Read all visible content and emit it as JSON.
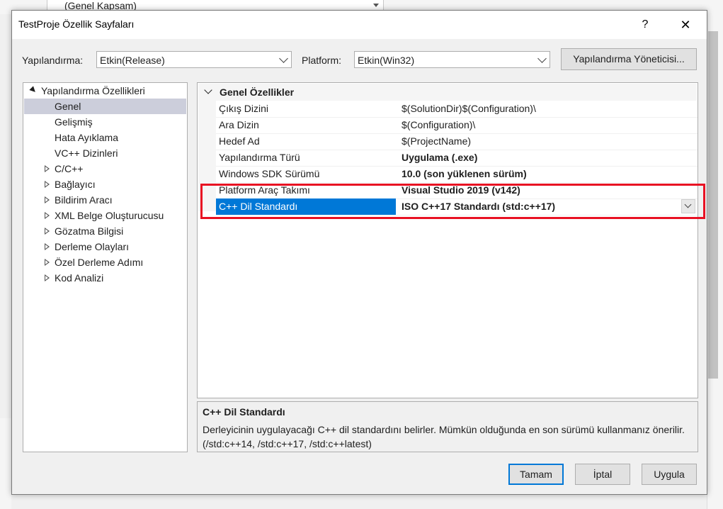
{
  "background": {
    "scope_combo": "(Genel Kapsam)"
  },
  "dialog": {
    "title": "TestProje Özellik Sayfaları",
    "help": "?",
    "close": "✕",
    "config_label": "Yapılandırma:",
    "config_value": "Etkin(Release)",
    "platform_label": "Platform:",
    "platform_value": "Etkin(Win32)",
    "config_manager_button": "Yapılandırma Yöneticisi..."
  },
  "tree": {
    "root": "Yapılandırma Özellikleri",
    "items": [
      {
        "label": "Genel",
        "selected": true,
        "expandable": false
      },
      {
        "label": "Gelişmiş",
        "expandable": false
      },
      {
        "label": "Hata Ayıklama",
        "expandable": false
      },
      {
        "label": "VC++ Dizinleri",
        "expandable": false
      },
      {
        "label": "C/C++",
        "expandable": true
      },
      {
        "label": "Bağlayıcı",
        "expandable": true
      },
      {
        "label": "Bildirim Aracı",
        "expandable": true
      },
      {
        "label": "XML Belge Oluşturucusu",
        "expandable": true
      },
      {
        "label": "Gözatma Bilgisi",
        "expandable": true
      },
      {
        "label": "Derleme Olayları",
        "expandable": true
      },
      {
        "label": "Özel Derleme Adımı",
        "expandable": true
      },
      {
        "label": "Kod Analizi",
        "expandable": true
      }
    ]
  },
  "grid": {
    "category": "Genel Özellikler",
    "rows": [
      {
        "name": "Çıkış Dizini",
        "value": "$(SolutionDir)$(Configuration)\\",
        "bold": false
      },
      {
        "name": "Ara Dizin",
        "value": "$(Configuration)\\",
        "bold": false
      },
      {
        "name": "Hedef Ad",
        "value": "$(ProjectName)",
        "bold": false
      },
      {
        "name": "Yapılandırma Türü",
        "value": "Uygulama (.exe)",
        "bold": true
      },
      {
        "name": "Windows SDK Sürümü",
        "value": "10.0 (son yüklenen sürüm)",
        "bold": true
      },
      {
        "name": "Platform Araç Takımı",
        "value": "Visual Studio 2019 (v142)",
        "bold": true
      },
      {
        "name": "C++ Dil Standardı",
        "value": "ISO C++17 Standardı (std:c++17)",
        "bold": true,
        "selected": true
      }
    ]
  },
  "description": {
    "title": "C++ Dil Standardı",
    "text": "Derleyicinin uygulayacağı C++ dil standardını belirler. Mümkün olduğunda en son sürümü kullanmanız önerilir. (/std:c++14, /std:c++17, /std:c++latest)"
  },
  "buttons": {
    "ok": "Tamam",
    "cancel": "İptal",
    "apply": "Uygula"
  },
  "colors": {
    "selection": "#0078d7",
    "highlight_box": "#e81123",
    "tree_selection": "#cccedb"
  }
}
